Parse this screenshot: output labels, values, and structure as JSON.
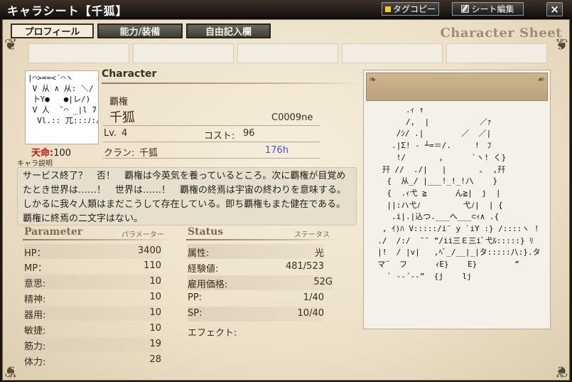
{
  "window": {
    "title": "キャラシート【千狐】",
    "tag_copy_label": "タグコピー",
    "sheet_edit_label": "シート編集",
    "close_label": "×"
  },
  "tabs": [
    {
      "label": "プロフィール",
      "active": true
    },
    {
      "label": "能力/装備",
      "active": false
    },
    {
      "label": "自由記入欄",
      "active": false
    }
  ],
  "sheet_label": "Character Sheet",
  "portrait": {
    "ascii": "|⌒>==<´⌒ヽ\n V 从 ∧ 从: ＼/\n 卜Y●   ●|レ/)\n V 人  ˘⌒ _|l 7\n  Vl.:: 兀:::ﾉ:ﾉ\\"
  },
  "life": {
    "label": "天命",
    "value": "100"
  },
  "char_desc_label": "キャラ説明",
  "character": {
    "header": "Character",
    "title": "覇権",
    "name": "千狐",
    "id": "C0009ne",
    "level_label": "Lv.",
    "level": "4",
    "cost_label": "コスト:",
    "cost": "96",
    "clan_label": "クラン:",
    "clan": "千狐",
    "clan_value": "176h",
    "accent_color": "#5050d0"
  },
  "description": "サービス終了？　否！　覇権は今英気を養っているところ。次に覇権が目覚めたとき世界は……！　世界は……！　覇権の終焉は宇宙の終わりを意味する。しかるに我々人類はまだこうして存在している。即ち覇権もまた健在である。覇権に終焉の二文字はない。",
  "parameter": {
    "title": "Parameter",
    "subtitle": "パラメーター",
    "rows": [
      {
        "label": "HP：",
        "value": "3400"
      },
      {
        "label": "MP：",
        "value": "110"
      },
      {
        "label": "意思:",
        "value": "10"
      },
      {
        "label": "精神:",
        "value": "10"
      },
      {
        "label": "器用:",
        "value": "10"
      },
      {
        "label": "敏捷:",
        "value": "10"
      },
      {
        "label": "筋力:",
        "value": "19"
      },
      {
        "label": "体力:",
        "value": "28"
      }
    ]
  },
  "status": {
    "title": "Status",
    "subtitle": "ステータス",
    "rows": [
      {
        "label": "属性:",
        "value": "光"
      },
      {
        "label": "経験値:",
        "value": "481/523"
      },
      {
        "label": "雇用価格:",
        "value": "52G"
      },
      {
        "label": "PP:",
        "value": "1/40"
      },
      {
        "label": "SP:",
        "value": "10/40"
      },
      {
        "label": "エフェクト:",
        "value": ""
      }
    ]
  },
  "ascii_art": "        .ｨ ↑\n        /,  |      　   ／ｧ\n      /ｼ/ .|        ／  ／|\n     .|Σ! - ┴=＝/.     !　ﾌ\n      !/       ,      `ヽ! く}\n   幵 //  ./|   |       ､  ,幵\n    {  从_/ |___!_!_!ﾉ\\    }\n    {  .ｨ弋 ≧      ん≧|  j  |\n    ||:ハ弋ﾉ         弋ﾉ|  | {\n     .i|.|込つ.___へ___⊂ｨ∧ .{\n   , ｲ)ﾊ V:::::/i¨ y `iY :} /::::ヽ !\n  ./  /:/  ¯¯ ”/ii三Ｅ三iﾞ弋ﾙ:::::} ﾘ\n  |!  / |v|   ,ﾍﾞ_/__|_|タ:::::八:}.タ\n  マ¨  フ      ｨE}    E}        ”\n    ` ‐‐´‐‐”  {j    lj"
}
